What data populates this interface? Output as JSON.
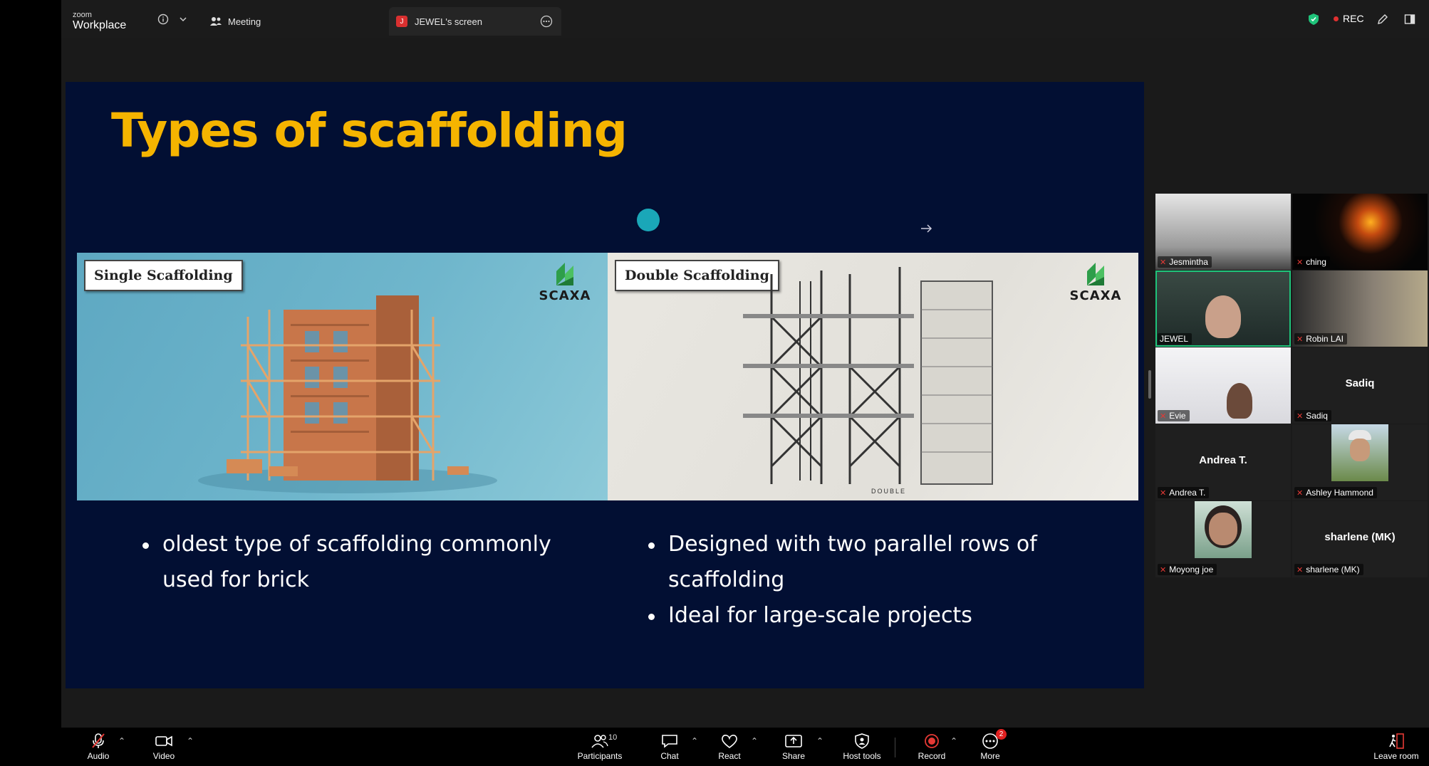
{
  "app": {
    "brand_small": "zoom",
    "brand_big": "Workplace"
  },
  "topbar": {
    "meeting_tab": "Meeting",
    "share_tab": "JEWEL's screen",
    "share_tab_badge": "J",
    "rec_label": "REC"
  },
  "slide": {
    "title": "Types of scaffolding",
    "left_label": "Single Scaffolding",
    "right_label": "Double Scaffolding",
    "logo_text": "SCAXA",
    "double_caption": "DOUBLE",
    "left_bullets": [
      "oldest type of scaffolding commonly used for brick"
    ],
    "right_bullets": [
      "Designed with two parallel rows of scaffolding",
      "Ideal for large-scale projects"
    ]
  },
  "participants": [
    {
      "name": "Jesmintha",
      "video": true,
      "muted": true
    },
    {
      "name": "ching",
      "video": true,
      "muted": true
    },
    {
      "name": "JEWEL",
      "video": true,
      "muted": false,
      "active": true
    },
    {
      "name": "Robin LAI",
      "video": true,
      "muted": true
    },
    {
      "name": "Evie",
      "video": true,
      "muted": true
    },
    {
      "name": "Sadiq",
      "video": false,
      "muted": true
    },
    {
      "name": "Andrea T.",
      "video": false,
      "muted": true
    },
    {
      "name": "Ashley Hammond",
      "video": false,
      "muted": true,
      "avatar": true
    },
    {
      "name": "Moyong joe",
      "video": false,
      "muted": true,
      "avatar": true
    },
    {
      "name": "sharlene (MK)",
      "video": false,
      "muted": true
    }
  ],
  "toolbar": {
    "audio": "Audio",
    "video": "Video",
    "participants": "Participants",
    "participants_count": "10",
    "chat": "Chat",
    "react": "React",
    "share": "Share",
    "host_tools": "Host tools",
    "record": "Record",
    "more": "More",
    "more_badge": "2",
    "leave": "Leave room"
  },
  "colors": {
    "slide_bg": "#020f33",
    "title": "#f5b400",
    "active_speaker": "#1fc37a",
    "mute": "#e53935"
  }
}
